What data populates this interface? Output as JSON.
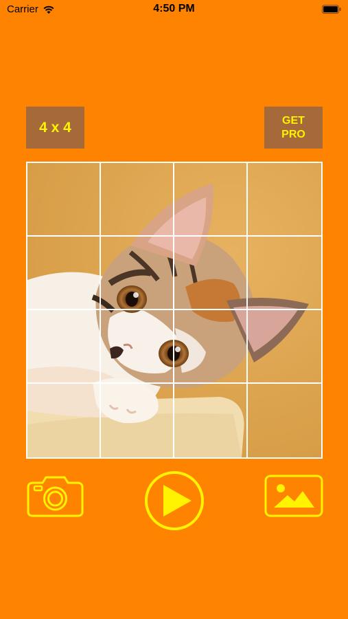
{
  "status_bar": {
    "carrier": "Carrier",
    "time": "4:50 PM"
  },
  "toolbar": {
    "grid_size_label": "4 x 4",
    "get_pro_label": "GET\nPRO"
  },
  "puzzle": {
    "rows": 4,
    "columns": 4,
    "image_subject": "kitten"
  },
  "bottom_bar": {
    "camera_icon": "camera-icon",
    "play_icon": "play-icon",
    "gallery_icon": "image-gallery-icon"
  },
  "colors": {
    "background": "#FE8300",
    "button_bg": "#A5693A",
    "accent_yellow": "#FFF301",
    "grid_lines": "#FFFFFF"
  }
}
